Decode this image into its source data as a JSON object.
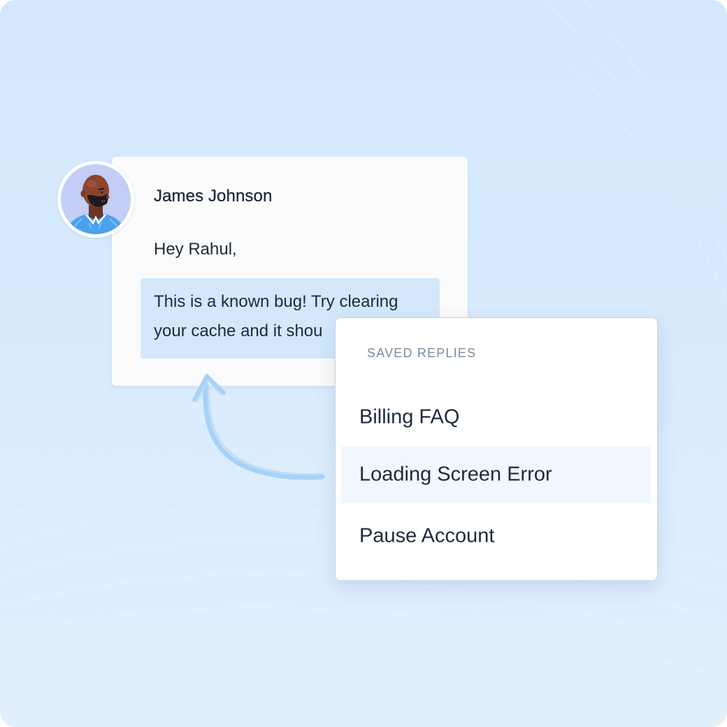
{
  "message": {
    "sender_name": "James Johnson",
    "greeting": "Hey Rahul,",
    "reply_line_1": "This is a known bug! Try clearing",
    "reply_line_2": "your cache and it shou"
  },
  "saved_replies": {
    "header": "SAVED REPLIES",
    "items": [
      {
        "label": "Billing FAQ",
        "selected": false
      },
      {
        "label": "Loading Screen Error",
        "selected": true
      },
      {
        "label": "Pause Account",
        "selected": false
      }
    ]
  },
  "colors": {
    "background": "#d6eafc",
    "highlight": "#d3e8fb",
    "selected_item": "#f0f7fe",
    "arrow": "#a7d2f7",
    "text": "#1d2b3c",
    "muted_text": "#7a8c9c"
  },
  "icons": {
    "avatar": "person-avatar",
    "arrow": "curved-arrow-icon"
  }
}
